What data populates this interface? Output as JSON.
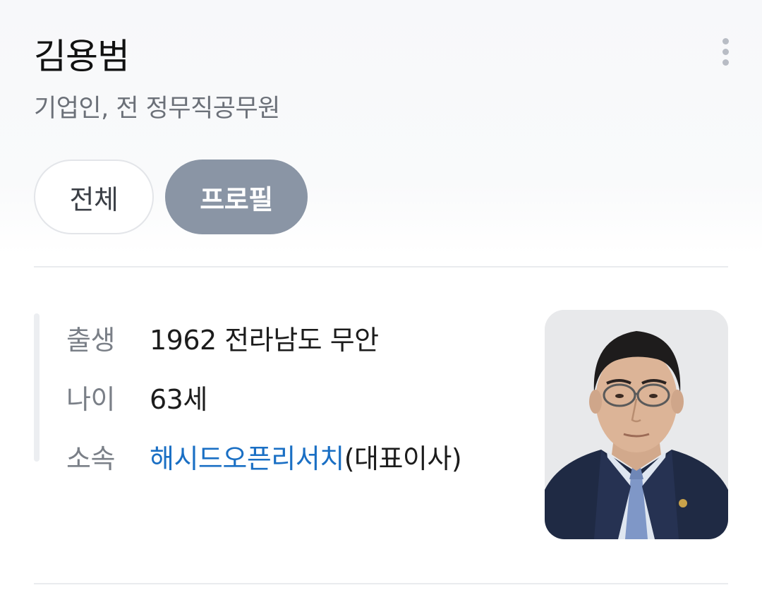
{
  "header": {
    "name": "김용범",
    "subtitle": "기업인, 전 정무직공무원"
  },
  "tabs": [
    {
      "label": "전체",
      "selected": false
    },
    {
      "label": "프로필",
      "selected": true
    }
  ],
  "profile": {
    "birth_label": "출생",
    "birth_value": "1962 전라남도 무안",
    "age_label": "나이",
    "age_value": "63세",
    "affiliation_label": "소속",
    "affiliation_link": "해시드오픈리서치",
    "affiliation_suffix": "(대표이사)"
  },
  "colors": {
    "link": "#1a6fc4",
    "tab_selected_bg": "#8a95a5",
    "subtitle": "#6b7078"
  },
  "icons": {
    "more": "more-vertical-icon"
  }
}
